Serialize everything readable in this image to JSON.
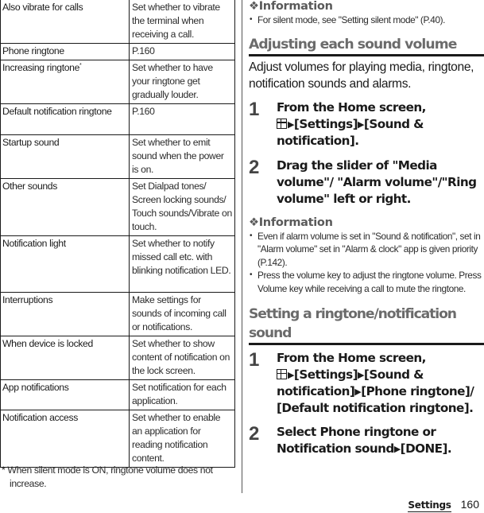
{
  "table": {
    "rows": [
      {
        "name": "Also vibrate for calls",
        "desc": "Set whether to vibrate the terminal when receiving a call."
      },
      {
        "name": "Phone ringtone",
        "desc": "P.160"
      },
      {
        "name": "Increasing ringtone",
        "mark": "*",
        "desc": "Set whether to have your ringtone get gradually louder."
      },
      {
        "name": "Default notification ringtone",
        "desc": "P.160"
      },
      {
        "name": "Startup sound",
        "desc": "Set whether to emit sound when the power is on."
      },
      {
        "name": "Other sounds",
        "desc": "Set Dialpad tones/ Screen locking sounds/ Touch sounds/Vibrate on touch."
      },
      {
        "name": "Notification light",
        "desc": "Set whether to notify missed call etc. with blinking notification LED."
      },
      {
        "name": "Interruptions",
        "desc": "Make settings for sounds of incoming call or notifications."
      },
      {
        "name": "When device is locked",
        "desc": "Set whether to show content of notification on the lock screen."
      },
      {
        "name": "App notifications",
        "desc": "Set notification for each application."
      },
      {
        "name": "Notification access",
        "desc": "Set whether to enable an application for reading notification content."
      }
    ],
    "footnote": "*  When silent mode is ON, ringtone volume does not increase."
  },
  "info1": {
    "heading": "❖Information",
    "items": [
      "For silent mode, see \"Setting silent mode\" (P.40)."
    ]
  },
  "section1": {
    "title": "Adjusting each sound volume",
    "lead": "Adjust volumes for playing media, ringtone, notification sounds and alarms.",
    "steps": [
      {
        "num": "1",
        "prefix": "From the Home screen,",
        "path": [
          "[Settings]",
          "[Sound & notification]."
        ]
      },
      {
        "num": "2",
        "text": "Drag the slider of \"Media volume\"/ \"Alarm volume\"/\"Ring volume\" left or right."
      }
    ]
  },
  "info2": {
    "heading": "❖Information",
    "items": [
      "Even if alarm volume is set in \"Sound & notification\", set in \"Alarm volume\" set in \"Alarm & clock\" app is given priority (P.142).",
      "Press the volume key to adjust the ringtone volume. Press Volume key while receiving a call to mute the ringtone."
    ]
  },
  "section2": {
    "title": "Setting a ringtone/notification sound",
    "steps": [
      {
        "num": "1",
        "prefix": "From the Home screen,",
        "path": [
          "[Settings]",
          "[Sound & notification]",
          "[Phone ringtone]/ [Default notification ringtone]."
        ]
      },
      {
        "num": "2",
        "text_a": "Select Phone ringtone or Notification sound",
        "text_b": "[DONE]."
      }
    ]
  },
  "icons": {
    "arrow": "▶"
  },
  "footer": {
    "label": "Settings",
    "page": "160"
  }
}
